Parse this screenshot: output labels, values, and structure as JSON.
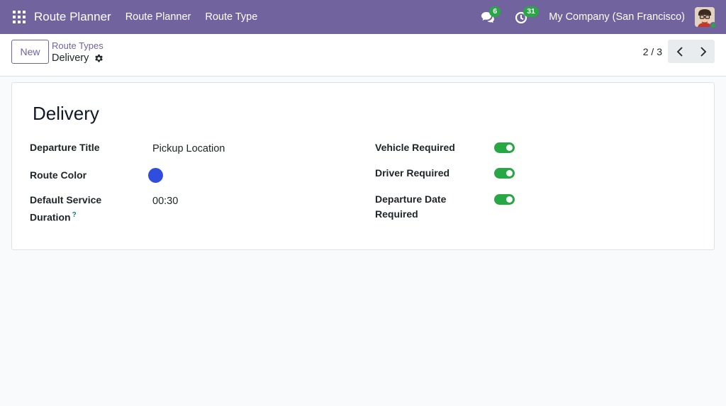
{
  "navbar": {
    "brand": "Route Planner",
    "menu": [
      "Route Planner",
      "Route Type"
    ],
    "messages_count": "6",
    "activities_count": "31",
    "company": "My Company (San Francisco)",
    "bg_color": "#71639e"
  },
  "control_panel": {
    "new_label": "New",
    "breadcrumb_parent": "Route Types",
    "breadcrumb_current": "Delivery",
    "pager": "2 / 3"
  },
  "form": {
    "title": "Delivery",
    "left_fields": {
      "departure_title_label": "Departure Title",
      "departure_title_value": "Pickup Location",
      "route_color_label": "Route Color",
      "route_color_value": "#2f4ee0",
      "default_service_duration_label_1": "Default Service",
      "default_service_duration_label_2": "Duration",
      "help_mark": "?",
      "default_service_duration_value": "00:30"
    },
    "right_fields": {
      "vehicle_required_label": "Vehicle Required",
      "vehicle_required": true,
      "driver_required_label": "Driver Required",
      "driver_required": true,
      "departure_date_required_label_1": "Departure Date",
      "departure_date_required_label_2": "Required",
      "departure_date_required": true
    },
    "toggle_on_color": "#28a745"
  }
}
